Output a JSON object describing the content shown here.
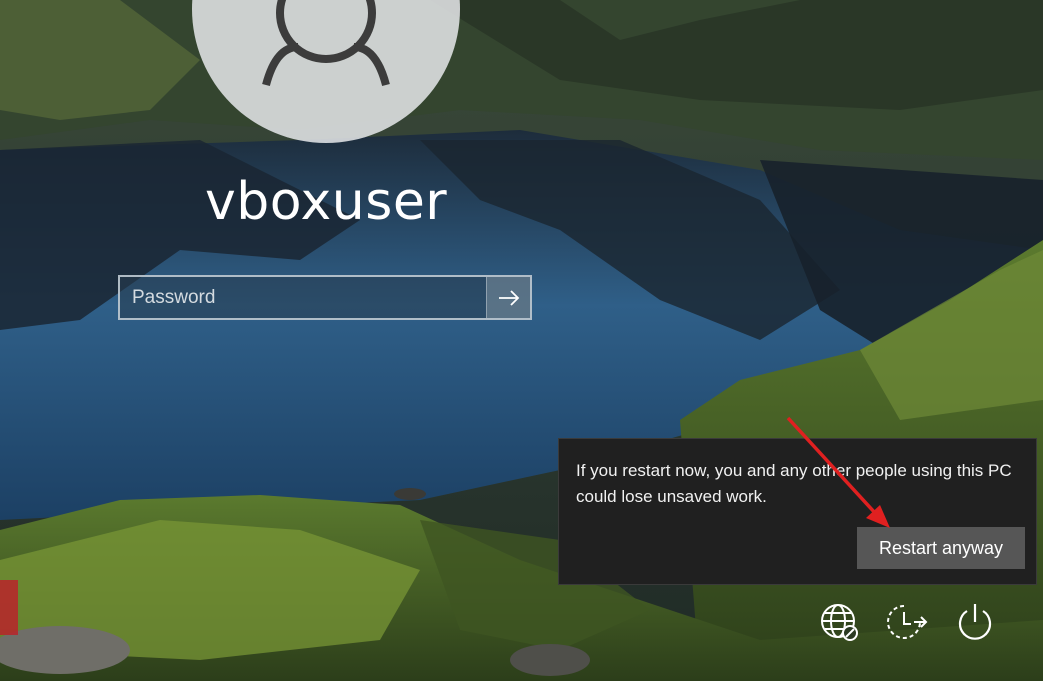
{
  "login": {
    "username": "vboxuser",
    "password_placeholder": "Password"
  },
  "restart_dialog": {
    "message": "If you restart now, you and any other people using this PC could lose unsaved work.",
    "button_label": "Restart anyway"
  },
  "tray": {
    "icons": [
      "network-icon",
      "accessibility-icon",
      "power-icon"
    ]
  },
  "colors": {
    "dialog_bg": "#202020",
    "button_bg": "#565656",
    "annotation_arrow": "#e02020"
  }
}
